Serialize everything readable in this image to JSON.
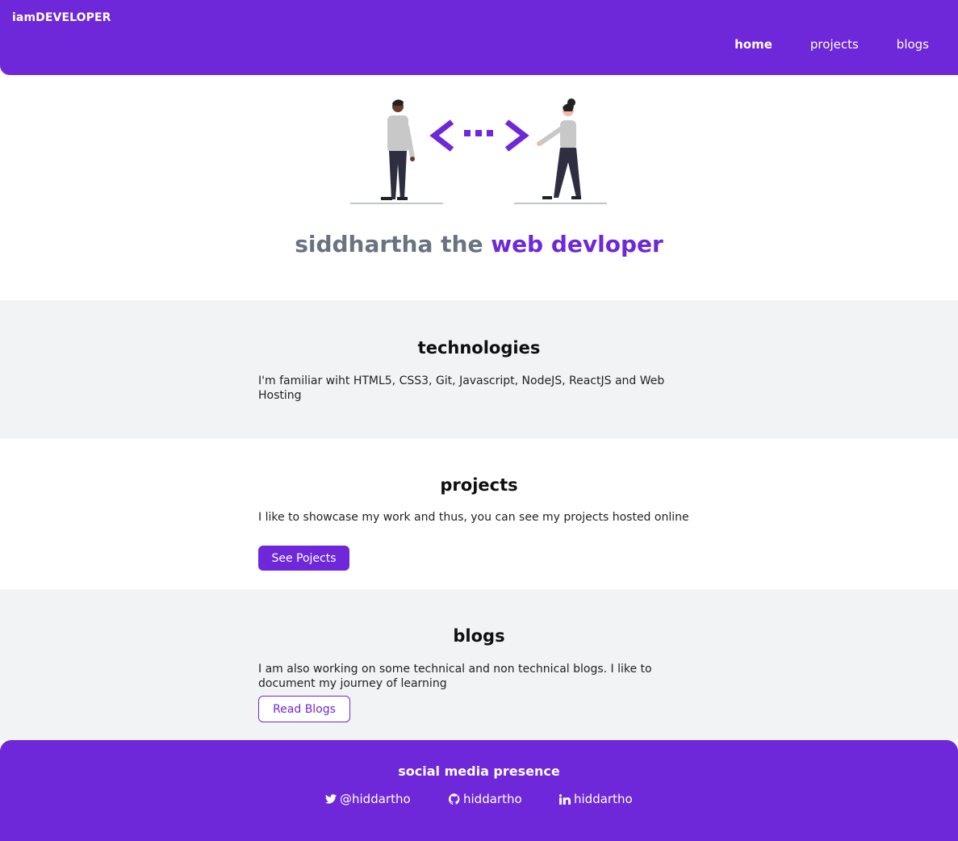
{
  "header": {
    "brand": "iamDEVELOPER",
    "nav": [
      {
        "label": "home",
        "active": true
      },
      {
        "label": "projects",
        "active": false
      },
      {
        "label": "blogs",
        "active": false
      }
    ]
  },
  "hero": {
    "name": "siddhartha the",
    "role": "web devloper"
  },
  "sections": {
    "technologies": {
      "title": "technologies",
      "text": "I'm familiar wiht HTML5, CSS3, Git, Javascript, NodeJS, ReactJS and Web Hosting"
    },
    "projects": {
      "title": "projects",
      "text": "I like to showcase my work and thus, you can see my projects hosted online",
      "button": "See Pojects"
    },
    "blogs": {
      "title": "blogs",
      "text": "I am also working on some technical and non technical blogs. I like to document my journey of learning",
      "button": "Read Blogs"
    }
  },
  "footer": {
    "title": "social media presence",
    "links": [
      {
        "icon": "twitter-icon",
        "label": "@hiddartho"
      },
      {
        "icon": "github-icon",
        "label": "hiddartho"
      },
      {
        "icon": "linkedin-icon",
        "label": "hiddartho"
      }
    ]
  },
  "colors": {
    "accent": "#6e28d9",
    "hero_gray": "#6b7280",
    "section_gray": "#f2f3f5"
  }
}
